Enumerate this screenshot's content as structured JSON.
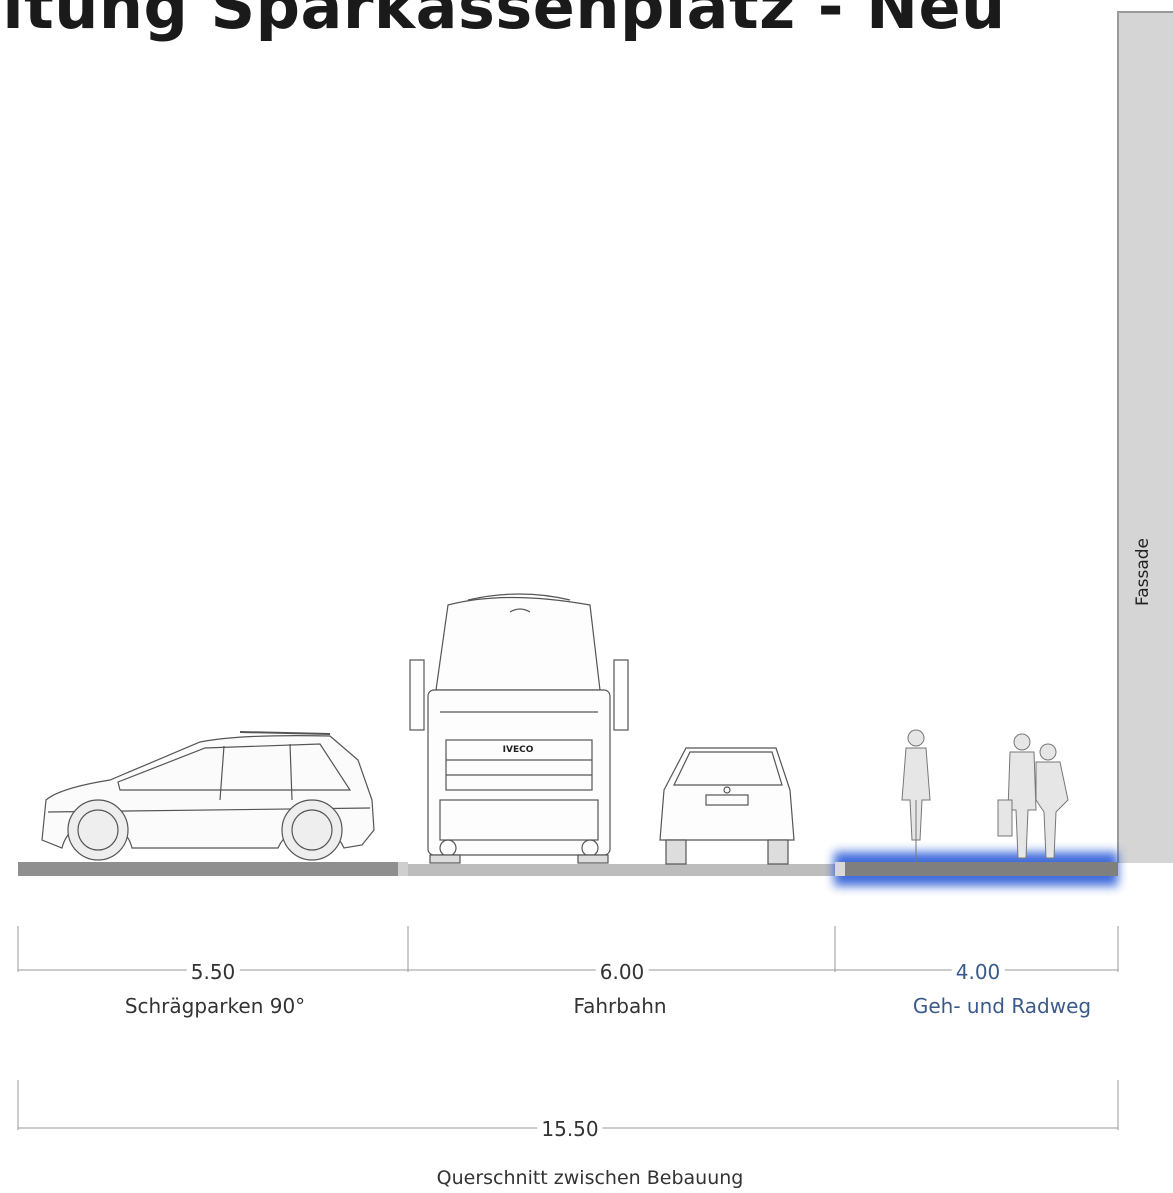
{
  "title": "altung Sparkassenplatz - Neu",
  "facade_label": "Fassade",
  "truck_badge": "IVECO",
  "segments": [
    {
      "width": "5.50",
      "label": "Schrägparken 90°"
    },
    {
      "width": "6.00",
      "label": "Fahrbahn"
    },
    {
      "width": "4.00",
      "label": "Geh- und Radweg"
    }
  ],
  "total": {
    "width": "15.50",
    "label": "Querschnitt zwischen Bebauung"
  },
  "colors": {
    "highlight": "#2a5bd7",
    "road": "#bdbdbd",
    "parking": "#8a8a8a",
    "facade": "#d5d5d5"
  }
}
